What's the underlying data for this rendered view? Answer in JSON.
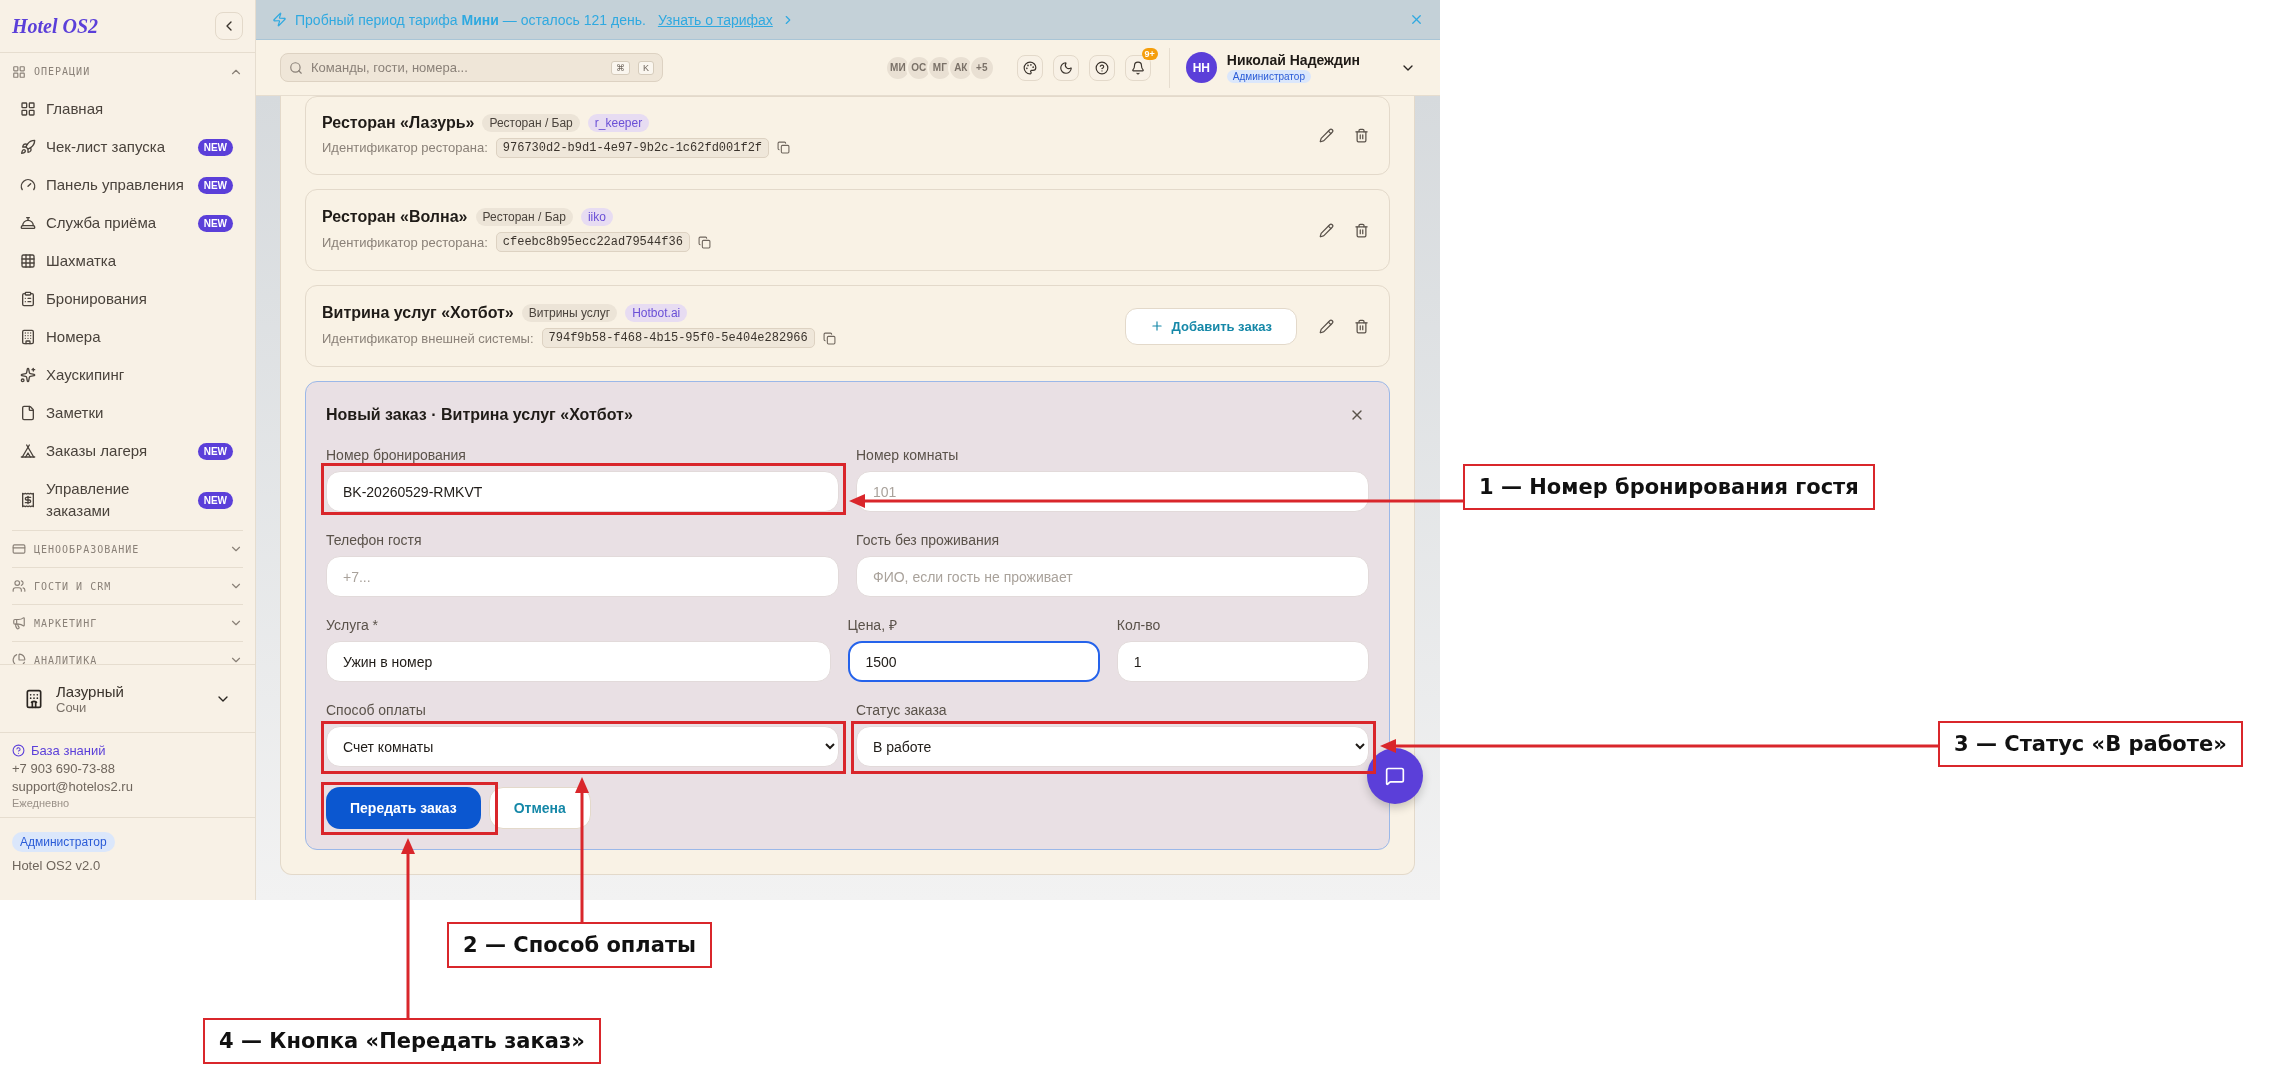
{
  "banner": {
    "text": "Пробный период тарифа **Мини** — осталось 121 день.",
    "link": "Узнать о тарифах"
  },
  "sidebar": {
    "logo": "Hotel OS2",
    "sections": [
      {
        "title": "ОПЕРАЦИИ",
        "expanded": true,
        "items": [
          {
            "label": "Главная"
          },
          {
            "label": "Чек-лист запуска",
            "badge": "NEW"
          },
          {
            "label": "Панель управления",
            "badge": "NEW"
          },
          {
            "label": "Служба приёма",
            "badge": "NEW"
          },
          {
            "label": "Шахматка"
          },
          {
            "label": "Бронирования"
          },
          {
            "label": "Номера"
          },
          {
            "label": "Хаускипинг"
          },
          {
            "label": "Заметки"
          },
          {
            "label": "Заказы лагеря",
            "badge": "NEW"
          },
          {
            "label": "Управление заказами",
            "badge": "NEW"
          }
        ]
      },
      {
        "title": "ЦЕНООБРАЗОВАНИЕ",
        "expanded": false
      },
      {
        "title": "ГОСТИ И CRM",
        "expanded": false
      },
      {
        "title": "МАРКЕТИНГ",
        "expanded": false
      },
      {
        "title": "АНАЛИТИКА",
        "expanded": false
      }
    ],
    "property": {
      "name": "Лазурный",
      "city": "Сочи"
    },
    "help": {
      "link": "База знаний",
      "phone": "+7 903 690-73-88",
      "email": "support@hotelos2.ru",
      "hours": "Ежедневно"
    },
    "role": "Администратор",
    "version": "Hotel OS2 v2.0"
  },
  "header": {
    "search_placeholder": "Команды, гости, номера...",
    "shortcut": [
      "⌘",
      "K"
    ],
    "team": [
      "МИ",
      "ОС",
      "МГ",
      "АК",
      "+5"
    ],
    "notifications": "9+",
    "user": {
      "initials": "НН",
      "name": "Николай Надеждин",
      "role": "Администратор"
    }
  },
  "integrations": [
    {
      "name": "Ресторан «Лазурь»",
      "category": "Ресторан / Бар",
      "system": "r_keeper",
      "id_label": "Идентификатор ресторана:",
      "id_value": "976730d2-b9d1-4e97-9b2c-1c62fd001f2f"
    },
    {
      "name": "Ресторан «Волна»",
      "category": "Ресторан / Бар",
      "system": "iiko",
      "id_label": "Идентификатор ресторана:",
      "id_value": "cfeebc8b95ecc22ad79544f36"
    },
    {
      "name": "Витрина услуг «Хотбот»",
      "category": "Витрины услуг",
      "system": "Hotbot.ai",
      "id_label": "Идентификатор внешней системы:",
      "id_value": "794f9b58-f468-4b15-95f0-5e404e282966",
      "action": "Добавить заказ"
    }
  ],
  "order_form": {
    "title": "Новый заказ · Витрина услуг «Хотбот»",
    "rows": [
      [
        {
          "kind": "input",
          "label": "Номер бронирования",
          "value": "BK-20260529-RMKVT",
          "focused": false
        },
        {
          "kind": "input",
          "label": "Номер комнаты",
          "placeholder": "101",
          "focused": false
        }
      ],
      [
        {
          "kind": "input",
          "label": "Телефон гостя",
          "placeholder": "+7...",
          "focused": false
        },
        {
          "kind": "input",
          "label": "Гость без проживания",
          "placeholder": "ФИО, если гость не проживает",
          "focused": false
        }
      ],
      [
        {
          "kind": "input",
          "label": "Услуга *",
          "value": "Ужин в номер",
          "focused": false
        },
        {
          "kind": "input",
          "label": "Цена, ₽",
          "value": "1500",
          "focused": true
        },
        {
          "kind": "input",
          "label": "Кол-во",
          "value": "1",
          "focused": false
        }
      ],
      [
        {
          "kind": "select",
          "label": "Способ оплаты",
          "value": "Счет комнаты",
          "focused": false
        },
        {
          "kind": "select",
          "label": "Статус заказа",
          "value": "В работе",
          "focused": false
        }
      ]
    ],
    "submit": "Передать заказ",
    "cancel": "Отмена"
  },
  "annotations": [
    {
      "label": "1 — Номер бронирования гостя"
    },
    {
      "label": "2 — Способ оплаты"
    },
    {
      "label": "3 — Статус «В работе»"
    },
    {
      "label": "4 — Кнопка «Передать заказ»"
    }
  ]
}
